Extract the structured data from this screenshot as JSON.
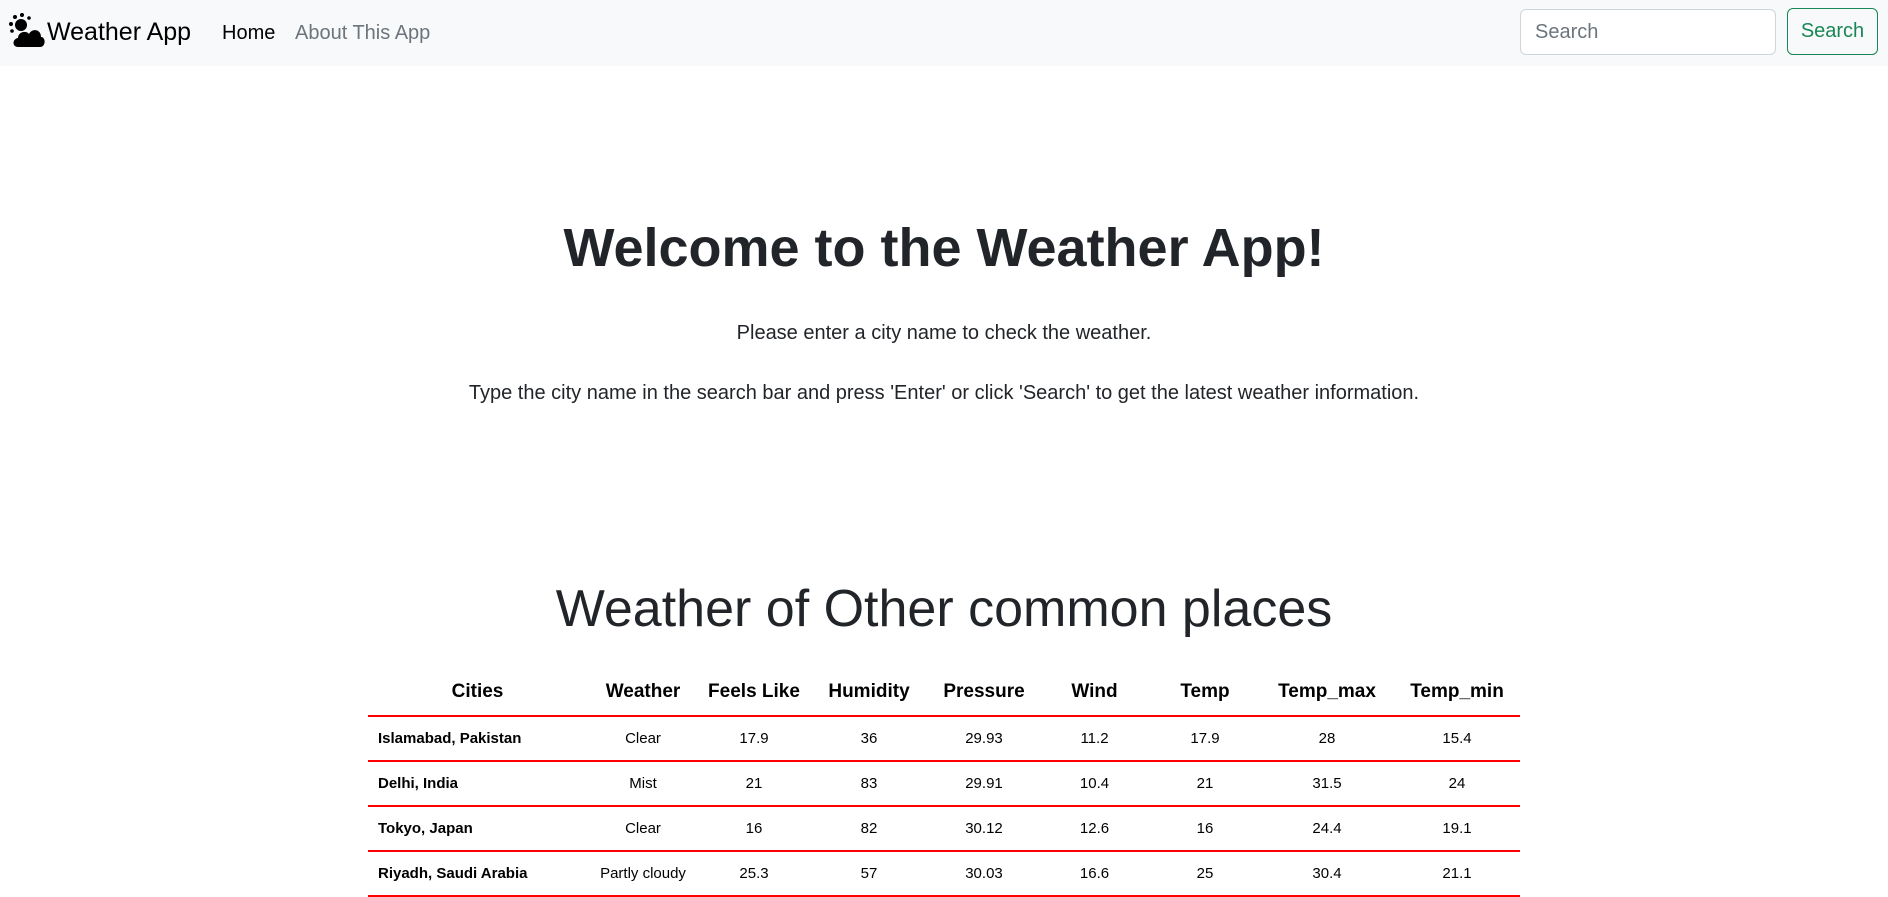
{
  "navbar": {
    "brand_text": "Weather App",
    "brand_icon": "weather-sun-cloud-icon",
    "links": [
      {
        "label": "Home",
        "active": true
      },
      {
        "label": "About This App",
        "active": false
      }
    ],
    "search": {
      "placeholder": "Search",
      "value": "",
      "button_label": "Search"
    }
  },
  "hero": {
    "title": "Welcome to the Weather App!",
    "line1": "Please enter a city name to check the weather.",
    "line2": "Type the city name in the search bar and press 'Enter' or click 'Search' to get the latest weather information."
  },
  "other_places": {
    "title": "Weather of Other common places",
    "columns": [
      "Cities",
      "Weather",
      "Feels Like",
      "Humidity",
      "Pressure",
      "Wind",
      "Temp",
      "Temp_max",
      "Temp_min"
    ],
    "rows": [
      {
        "city": "Islamabad, Pakistan",
        "weather": "Clear",
        "feels_like": "17.9",
        "humidity": "36",
        "pressure": "29.93",
        "wind": "11.2",
        "temp": "17.9",
        "temp_max": "28",
        "temp_min": "15.4"
      },
      {
        "city": "Delhi, India",
        "weather": "Mist",
        "feels_like": "21",
        "humidity": "83",
        "pressure": "29.91",
        "wind": "10.4",
        "temp": "21",
        "temp_max": "31.5",
        "temp_min": "24"
      },
      {
        "city": "Tokyo, Japan",
        "weather": "Clear",
        "feels_like": "16",
        "humidity": "82",
        "pressure": "30.12",
        "wind": "12.6",
        "temp": "16",
        "temp_max": "24.4",
        "temp_min": "19.1"
      },
      {
        "city": "Riyadh, Saudi Arabia",
        "weather": "Partly cloudy",
        "feels_like": "25.3",
        "humidity": "57",
        "pressure": "30.03",
        "wind": "16.6",
        "temp": "25",
        "temp_max": "30.4",
        "temp_min": "21.1"
      }
    ]
  },
  "colors": {
    "navbar_bg": "#f8f9fa",
    "search_button": "#198754",
    "table_row_border": "#ff0000",
    "muted_link": "#6c757d"
  }
}
